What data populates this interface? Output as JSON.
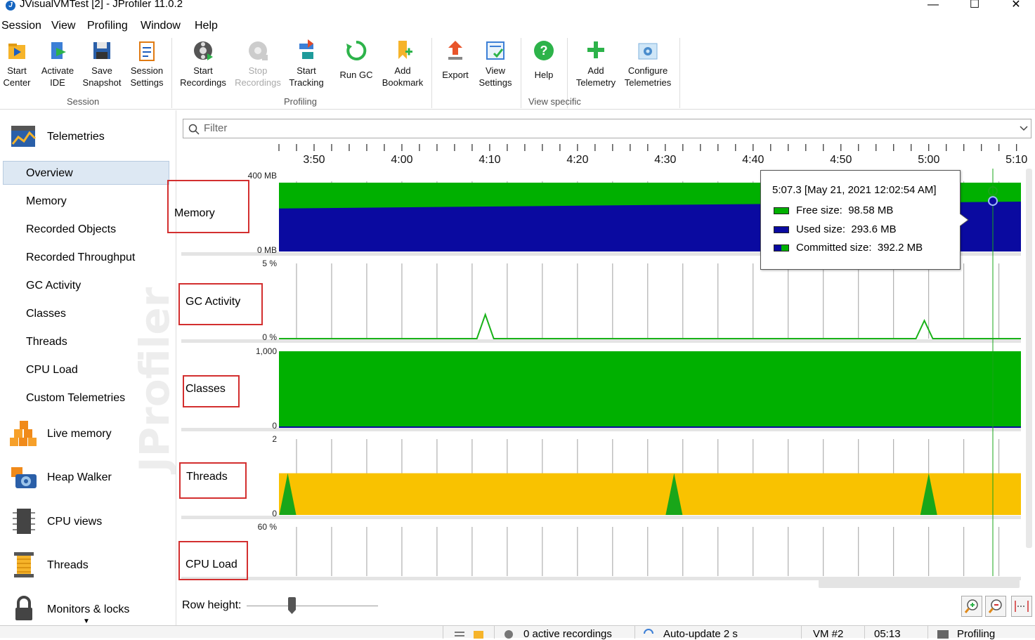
{
  "window": {
    "title": "JVisualVMTest [2] - JProfiler 11.0.2",
    "controls": [
      "—",
      "☐",
      "✕"
    ]
  },
  "menu": [
    "Session",
    "View",
    "Profiling",
    "Window",
    "Help"
  ],
  "toolbar": {
    "buttons": [
      {
        "label1": "Start",
        "label2": "Center",
        "icon": "start-center-icon",
        "enabled": true
      },
      {
        "label1": "Activate",
        "label2": "IDE",
        "icon": "activate-ide-icon",
        "enabled": true
      },
      {
        "label1": "Save",
        "label2": "Snapshot",
        "icon": "save-snapshot-icon",
        "enabled": true
      },
      {
        "label1": "Session",
        "label2": "Settings",
        "icon": "session-settings-icon",
        "enabled": true
      },
      {
        "label1": "Start",
        "label2": "Recordings",
        "icon": "start-recordings-icon",
        "enabled": true
      },
      {
        "label1": "Stop",
        "label2": "Recordings",
        "icon": "stop-recordings-icon",
        "enabled": false
      },
      {
        "label1": "Start",
        "label2": "Tracking",
        "icon": "start-tracking-icon",
        "enabled": true
      },
      {
        "label1": "Run GC",
        "label2": "",
        "icon": "run-gc-icon",
        "enabled": true
      },
      {
        "label1": "Add",
        "label2": "Bookmark",
        "icon": "add-bookmark-icon",
        "enabled": true
      },
      {
        "label1": "Export",
        "label2": "",
        "icon": "export-icon",
        "enabled": true
      },
      {
        "label1": "View",
        "label2": "Settings",
        "icon": "view-settings-icon",
        "enabled": true
      },
      {
        "label1": "Help",
        "label2": "",
        "icon": "help-icon",
        "enabled": true
      },
      {
        "label1": "Add",
        "label2": "Telemetry",
        "icon": "add-telemetry-icon",
        "enabled": true
      },
      {
        "label1": "Configure",
        "label2": "Telemetries",
        "icon": "configure-telemetries-icon",
        "enabled": true
      }
    ],
    "groups": [
      "Session",
      "Profiling",
      "View specific"
    ]
  },
  "sidebar": {
    "header": "Telemetries",
    "sub_items": [
      "Overview",
      "Memory",
      "Recorded Objects",
      "Recorded Throughput",
      "GC Activity",
      "Classes",
      "Threads",
      "CPU Load",
      "Custom Telemetries"
    ],
    "selected": "Overview",
    "sections": [
      "Live memory",
      "Heap Walker",
      "CPU views",
      "Threads",
      "Monitors & locks"
    ],
    "watermark": "JProfiler"
  },
  "filter": {
    "placeholder": "Filter"
  },
  "timeline": {
    "ticks": [
      "3:50",
      "4:00",
      "4:10",
      "4:20",
      "4:30",
      "4:40",
      "4:50",
      "5:00",
      "5:10"
    ]
  },
  "rows": [
    {
      "name": "Memory",
      "ymax": "400 MB",
      "ymin": "0 MB"
    },
    {
      "name": "GC Activity",
      "ymax": "5 %",
      "ymin": "0 %"
    },
    {
      "name": "Classes",
      "ymax": "1,000",
      "ymin": "0"
    },
    {
      "name": "Threads",
      "ymax": "2",
      "ymin": "0"
    },
    {
      "name": "CPU Load",
      "ymax": "60 %",
      "ymin": ""
    }
  ],
  "chart_data": [
    {
      "type": "area",
      "title": "Memory",
      "x_unit": "m:s",
      "ylim": [
        0,
        400
      ],
      "y_unit": "MB",
      "x": [
        "3:46",
        "5:10"
      ],
      "series": [
        {
          "name": "Used size",
          "values": [
            250,
            290
          ],
          "color": "#0a0aa0"
        },
        {
          "name": "Free size",
          "values": [
            150,
            110
          ],
          "color": "#00b000"
        }
      ]
    },
    {
      "type": "line",
      "title": "GC Activity",
      "ylim": [
        0,
        5
      ],
      "y_unit": "%",
      "peaks": [
        {
          "x": "4:09.5",
          "y": 1.6
        },
        {
          "x": "4:59.5",
          "y": 1.2
        }
      ],
      "color": "#19b219"
    },
    {
      "type": "area",
      "title": "Classes",
      "ylim": [
        0,
        1000
      ],
      "values": [
        1000,
        1000
      ],
      "color": "#00b000"
    },
    {
      "type": "area",
      "title": "Threads",
      "ylim": [
        0,
        2
      ],
      "series": [
        {
          "name": "Threads",
          "values": [
            1.1,
            1.1
          ],
          "color": "#f9c200"
        }
      ],
      "spikes": [
        "3:47",
        "4:31",
        "5:00"
      ]
    },
    {
      "type": "line",
      "title": "CPU Load",
      "ylim": [
        0,
        60
      ],
      "y_unit": "%"
    }
  ],
  "tooltip": {
    "title": "5:07.3 [May 21, 2021 12:02:54 AM]",
    "free_label": "Free size:",
    "free_value": "98.58 MB",
    "used_label": "Used size:",
    "used_value": "293.6 MB",
    "committed_label": "Committed size:",
    "committed_value": "392.2 MB"
  },
  "bottom": {
    "row_height_label": "Row height:"
  },
  "statusbar": {
    "recordings": "0 active recordings",
    "autoupdate": "Auto-update 2 s",
    "vm": "VM #2",
    "time": "05:13",
    "status": "Profiling"
  },
  "colors": {
    "used": "#0a0aa0",
    "free": "#00b000",
    "threads": "#f9c200",
    "label_border": "#d32f2f",
    "selection": "#dde8f3"
  }
}
